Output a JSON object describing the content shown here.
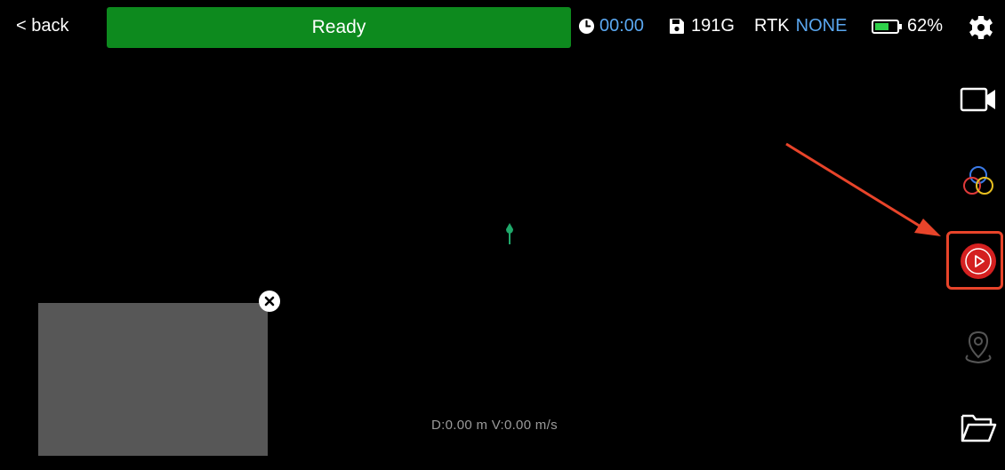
{
  "header": {
    "back_label": "< back",
    "status_text": "Ready",
    "timer": "00:00",
    "storage": "191G",
    "rtk_label": "RTK",
    "rtk_status": "NONE",
    "battery": "62%"
  },
  "icons": {
    "clock": "clock-icon",
    "storage": "save-icon",
    "battery": "battery-icon",
    "settings": "gear-icon",
    "camera": "video-camera-icon",
    "color": "color-circles-icon",
    "play": "play-icon",
    "location": "location-pin-icon",
    "folder": "folder-icon",
    "close": "close-icon"
  },
  "footer": {
    "readout": "D:0.00 m V:0.00 m/s"
  },
  "colors": {
    "status_green": "#0d8a1e",
    "rtk_blue": "#5aa7f0",
    "play_red": "#d42020",
    "highlight": "#e8442a",
    "marker": "#1fa86a"
  }
}
